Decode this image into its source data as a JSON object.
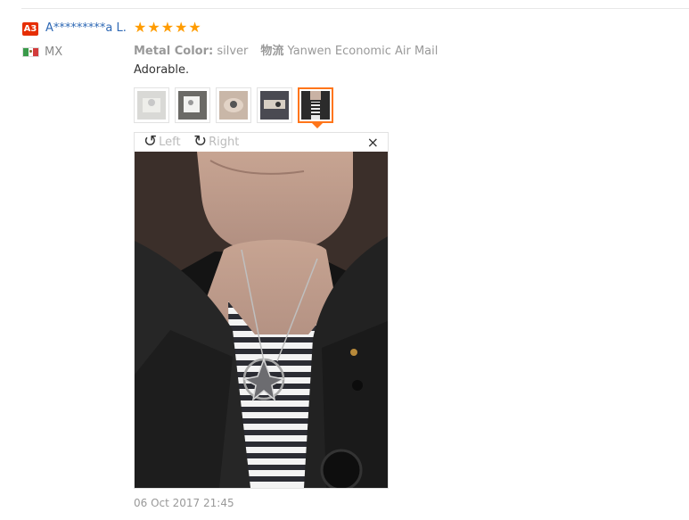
{
  "review": {
    "level_badge": "A3",
    "username": "A*********a L.",
    "stars": [
      "★",
      "★",
      "★",
      "★",
      "★"
    ],
    "country": "MX",
    "metal_color_label": "Metal Color:",
    "metal_color_value": "silver",
    "logistics_label": "物流",
    "logistics_value": "Yanwen Economic Air Mail",
    "text": "Adorable.",
    "date": "06 Oct 2017 21:45"
  },
  "viewer": {
    "rotate_left": "Left",
    "rotate_right": "Right",
    "close": "×",
    "rotate_left_icon": "↺",
    "rotate_right_icon": "↻"
  },
  "colors": {
    "star": "#ff9c00",
    "accent": "#ff7519",
    "badge": "#e62e04",
    "link": "#2f69b5"
  }
}
